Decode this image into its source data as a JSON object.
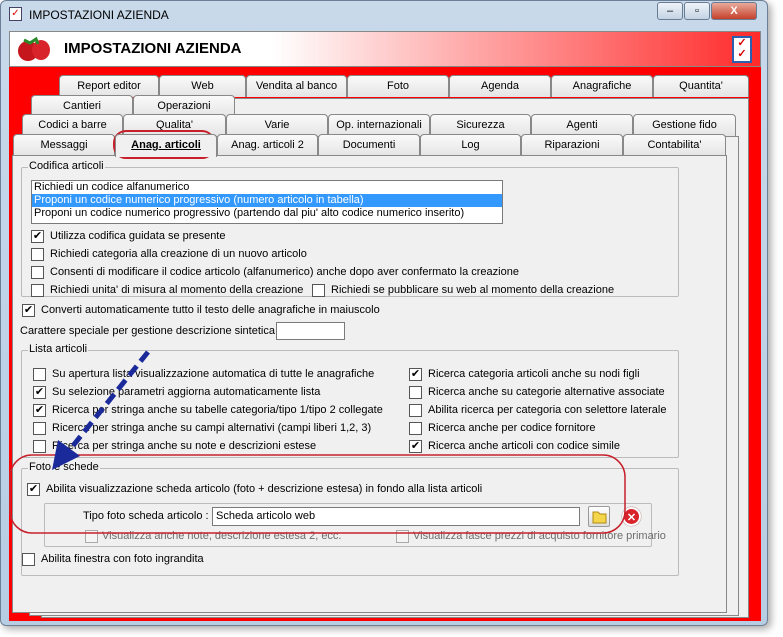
{
  "window": {
    "title": "IMPOSTAZIONI AZIENDA",
    "header_title": "IMPOSTAZIONI AZIENDA",
    "minimize": "‒",
    "maximize": "▫",
    "close": "X"
  },
  "tabs": {
    "row1": [
      "Report editor",
      "Web",
      "Vendita al banco",
      "Foto",
      "Agenda",
      "Anagrafiche",
      "Quantita'"
    ],
    "row2": [
      "Cantieri",
      "Operazioni"
    ],
    "row3": [
      "Codici a barre",
      "Qualita'",
      "Varie",
      "Op. internazionali",
      "Sicurezza",
      "Agenti",
      "Gestione fido"
    ],
    "row4": [
      "Messaggi",
      "Anag. articoli",
      "Anag. articoli 2",
      "Documenti",
      "Log",
      "Riparazioni",
      "Contabilita'"
    ],
    "active": "Anag. articoli"
  },
  "codifica": {
    "legend": "Codifica articoli",
    "list": [
      "Richiedi un codice alfanumerico",
      "Proponi un codice numerico progressivo (numero articolo in tabella)",
      "Proponi un codice numerico progressivo (partendo dal piu' alto codice numerico inserito)"
    ],
    "selected_index": 1,
    "checks": [
      {
        "label": "Utilizza codifica guidata se presente",
        "checked": true
      },
      {
        "label": "Richiedi categoria alla creazione di un nuovo articolo",
        "checked": false
      },
      {
        "label": "Consenti di modificare il codice articolo (alfanumerico) anche dopo aver confermato la creazione",
        "checked": false
      },
      {
        "label": "Richiedi unita' di misura al momento della creazione",
        "checked": false
      },
      {
        "label": "Richiedi se pubblicare su web al momento della creazione",
        "checked": false
      }
    ]
  },
  "converti": {
    "label": "Converti automaticamente tutto il testo delle anagrafiche in maiuscolo",
    "checked": true
  },
  "carattere": {
    "label": "Carattere speciale per gestione descrizione sintetica :",
    "value": ""
  },
  "lista": {
    "legend": "Lista articoli",
    "left": [
      {
        "label": "Su apertura lista visualizzazione automatica di tutte le anagrafiche",
        "checked": false
      },
      {
        "label": "Su selezione parametri aggiorna automaticamente lista",
        "checked": true
      },
      {
        "label": "Ricerca per stringa anche su tabelle categoria/tipo 1/tipo 2 collegate",
        "checked": true
      },
      {
        "label": "Ricerca per stringa anche su campi alternativi (campi liberi 1,2, 3)",
        "checked": false
      },
      {
        "label": "Ricerca per stringa anche su note e descrizioni estese",
        "checked": false
      }
    ],
    "right": [
      {
        "label": "Ricerca categoria articoli anche su nodi figli",
        "checked": true
      },
      {
        "label": "Ricerca anche su categorie alternative associate",
        "checked": false
      },
      {
        "label": "Abilita ricerca per categoria con selettore laterale",
        "checked": false
      },
      {
        "label": "Ricerca anche per codice fornitore",
        "checked": false
      },
      {
        "label": "Ricerca anche articoli con codice simile",
        "checked": true
      }
    ]
  },
  "foto": {
    "legend": "Foto e schede",
    "abilita": {
      "label": "Abilita visualizzazione scheda articolo (foto + descrizione estesa) in fondo alla lista articoli",
      "checked": true
    },
    "tipo_label": "Tipo foto scheda articolo :",
    "tipo_value": "Scheda articolo web",
    "note": {
      "label": "Visualizza anche note, descrizione estesa 2, ecc.",
      "checked": false
    },
    "fasce": {
      "label": "Visualizza fasce prezzi di acquisto fornitore primario",
      "checked": false
    }
  },
  "finestra": {
    "label": "Abilita finestra con foto ingrandita",
    "checked": false
  },
  "colors": {
    "accent_red": "#ff0000",
    "selection": "#3399ff",
    "annotation_red": "#c8202a",
    "arrow_blue": "#1a2a9a"
  }
}
